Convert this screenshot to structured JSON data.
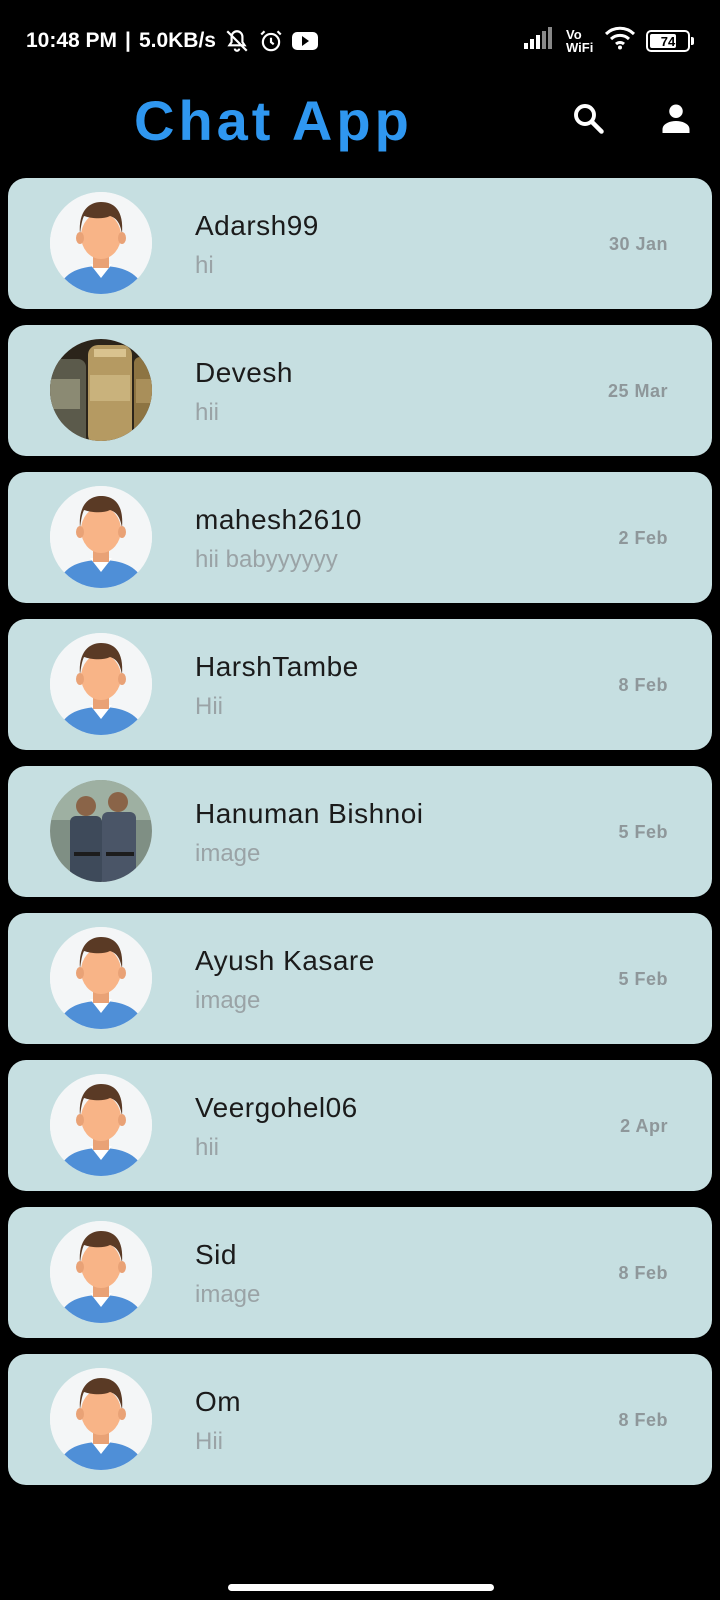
{
  "status_bar": {
    "time": "10:48 PM",
    "network_speed": "5.0KB/s",
    "separator": "|",
    "icons": [
      "mute-bell-icon",
      "alarm-icon",
      "youtube-icon",
      "signal-icon",
      "wifi-icon"
    ],
    "vowifi_line1": "Vo",
    "vowifi_line2": "WiFi",
    "battery_level": "74"
  },
  "app_bar": {
    "title": "Chat App",
    "title_color": "#2f97f0",
    "actions": [
      "search-icon",
      "person-icon"
    ]
  },
  "colors": {
    "background": "#000000",
    "card": "#c6dfe1",
    "name_text": "#1b1b1b",
    "message_text": "#9aa3a6",
    "date_text": "#8e979a"
  },
  "chats": [
    {
      "name": "Adarsh99",
      "message": "hi",
      "date": "30 Jan",
      "avatar": "default-avatar"
    },
    {
      "name": "Devesh",
      "message": "hii",
      "date": "25 Mar",
      "avatar": "photo-bottles"
    },
    {
      "name": "mahesh2610",
      "message": "hii babyyyyyy",
      "date": "2 Feb",
      "avatar": "default-avatar"
    },
    {
      "name": "HarshTambe",
      "message": "Hii",
      "date": "8 Feb",
      "avatar": "default-avatar"
    },
    {
      "name": "Hanuman Bishnoi",
      "message": "image",
      "date": "5 Feb",
      "avatar": "photo-two-people"
    },
    {
      "name": "Ayush Kasare",
      "message": "image",
      "date": "5 Feb",
      "avatar": "default-avatar"
    },
    {
      "name": "Veergohel06",
      "message": "hii",
      "date": "2 Apr",
      "avatar": "default-avatar"
    },
    {
      "name": "Sid",
      "message": "image",
      "date": "8 Feb",
      "avatar": "default-avatar"
    },
    {
      "name": "Om",
      "message": "Hii",
      "date": "8 Feb",
      "avatar": "default-avatar"
    }
  ]
}
